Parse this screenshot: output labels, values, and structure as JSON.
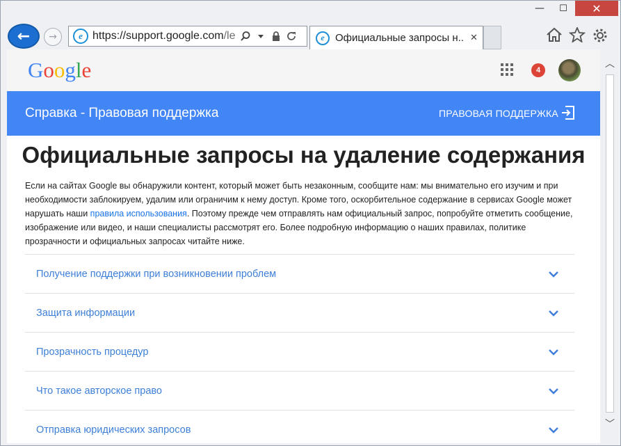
{
  "window": {
    "minimize_glyph": "—",
    "maximize_glyph": "☐",
    "close_glyph": "✕"
  },
  "toolbar": {
    "back_glyph": "←",
    "forward_glyph": "→",
    "url_host": "https://support.google.com",
    "url_path": "/leg",
    "tab_title": "Официальные запросы н...",
    "tab_close_glyph": "✕"
  },
  "icons": {
    "browser": "ie-icon",
    "search": "search-icon",
    "dropdown": "dropdown-icon",
    "lock": "lock-icon",
    "refresh": "refresh-icon",
    "home": "home-icon",
    "favorites": "star-icon",
    "settings": "gear-icon"
  },
  "google_header": {
    "logo_letters": [
      "G",
      "o",
      "o",
      "g",
      "l",
      "e"
    ],
    "logo_colors": [
      "#4285f4",
      "#ea4335",
      "#fbbc05",
      "#4285f4",
      "#34a853",
      "#ea4335"
    ],
    "notification_count": "4"
  },
  "bluebar": {
    "title": "Справка - Правовая поддержка",
    "link": "ПРАВОВАЯ ПОДДЕРЖКА",
    "color": "#4285f4"
  },
  "article": {
    "title": "Официальные запросы на удаление содержания",
    "intro_before_link": "Если на сайтах Google вы обнаружили контент, который может быть незаконным, сообщите нам: мы внимательно его изучим и при необходимости заблокируем, удалим или ограничим к нему доступ. Кроме того, оскорбительное содержание в сервисах Google может нарушать наши ",
    "intro_link": "правила использования",
    "intro_after_link": ". Поэтому прежде чем отправлять нам официальный запрос, попробуйте отметить сообщение, изображение или видео, и наши специалисты рассмотрят его. Более подробную информацию о наших правилах, политике прозрачности и официальных запросах читайте ниже."
  },
  "accordion": {
    "items": [
      {
        "label": "Получение поддержки при возникновении проблем"
      },
      {
        "label": "Защита информации"
      },
      {
        "label": "Прозрачность процедур"
      },
      {
        "label": "Что такое авторское право"
      },
      {
        "label": "Отправка юридических запросов"
      }
    ]
  },
  "scrollbar": {
    "up_glyph": "︿",
    "down_glyph": "﹀"
  }
}
